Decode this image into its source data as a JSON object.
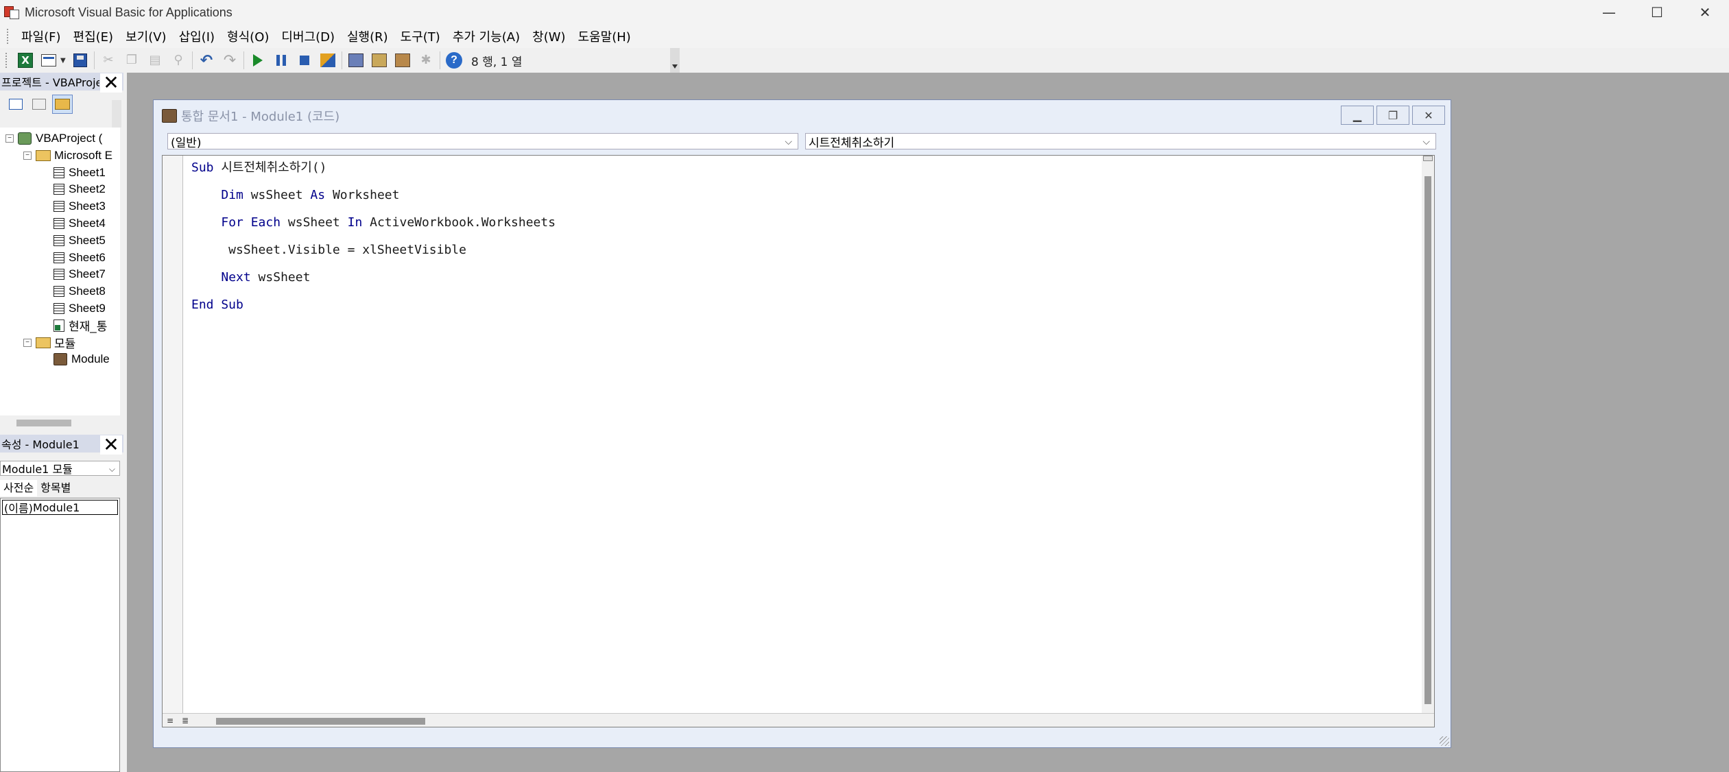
{
  "window": {
    "title": "Microsoft Visual Basic for Applications",
    "minimize": "—",
    "maximize": "☐",
    "close": "✕"
  },
  "menu": [
    "파일(F)",
    "편집(E)",
    "보기(V)",
    "삽입(I)",
    "형식(O)",
    "디버그(D)",
    "실행(R)",
    "도구(T)",
    "추가 기능(A)",
    "창(W)",
    "도움말(H)"
  ],
  "toolbar": {
    "cursor_position": "8 행, 1 열",
    "icons": [
      "excel-view-icon",
      "insert-userform-icon",
      "save-icon",
      "cut-icon",
      "copy-icon",
      "paste-icon",
      "find-icon",
      "undo-icon",
      "redo-icon",
      "run-icon",
      "break-icon",
      "reset-icon",
      "design-mode-icon",
      "project-explorer-icon",
      "properties-window-icon",
      "object-browser-icon",
      "toolbox-icon",
      "help-icon"
    ]
  },
  "project_pane": {
    "title": "프로젝트 - VBAProje",
    "close": "✕",
    "tree": [
      {
        "label": "VBAProject (",
        "level": 0,
        "toggle": "−",
        "icon": "vbaproject"
      },
      {
        "label": "Microsoft E",
        "level": 1,
        "toggle": "−",
        "icon": "folder"
      },
      {
        "label": "Sheet1",
        "level": 2,
        "icon": "sheet"
      },
      {
        "label": "Sheet2",
        "level": 2,
        "icon": "sheet"
      },
      {
        "label": "Sheet3",
        "level": 2,
        "icon": "sheet"
      },
      {
        "label": "Sheet4",
        "level": 2,
        "icon": "sheet"
      },
      {
        "label": "Sheet5",
        "level": 2,
        "icon": "sheet"
      },
      {
        "label": "Sheet6",
        "level": 2,
        "icon": "sheet"
      },
      {
        "label": "Sheet7",
        "level": 2,
        "icon": "sheet"
      },
      {
        "label": "Sheet8",
        "level": 2,
        "icon": "sheet"
      },
      {
        "label": "Sheet9",
        "level": 2,
        "icon": "sheet"
      },
      {
        "label": "현재_통",
        "level": 2,
        "icon": "workbook"
      },
      {
        "label": "모듈",
        "level": 1,
        "toggle": "−",
        "icon": "folder"
      },
      {
        "label": "Module",
        "level": 2,
        "icon": "module"
      }
    ]
  },
  "properties_pane": {
    "title": "속성 - Module1",
    "close": "✕",
    "object_select": "Module1 모듈",
    "tabs": [
      "사전순",
      "항목별"
    ],
    "rows": [
      {
        "key": "(이름)",
        "value": "Module1"
      }
    ]
  },
  "code_window": {
    "title": "통합 문서1 - Module1 (코드)",
    "object_combo": "(일반)",
    "procedure_combo": "시트전체취소하기",
    "lines": [
      [
        {
          "t": "Sub",
          "kw": true
        },
        {
          "t": " 시트전체취소하기()"
        }
      ],
      [
        {
          "t": "    "
        },
        {
          "t": "Dim",
          "kw": true
        },
        {
          "t": " wsSheet "
        },
        {
          "t": "As",
          "kw": true
        },
        {
          "t": " Worksheet"
        }
      ],
      [
        {
          "t": "    "
        },
        {
          "t": "For Each",
          "kw": true
        },
        {
          "t": " wsSheet "
        },
        {
          "t": "In",
          "kw": true
        },
        {
          "t": " ActiveWorkbook.Worksheets"
        }
      ],
      [
        {
          "t": "     wsSheet.Visible = xlSheetVisible"
        }
      ],
      [
        {
          "t": "    "
        },
        {
          "t": "Next",
          "kw": true
        },
        {
          "t": " wsSheet"
        }
      ],
      [
        {
          "t": "End Sub",
          "kw": true
        }
      ]
    ]
  }
}
